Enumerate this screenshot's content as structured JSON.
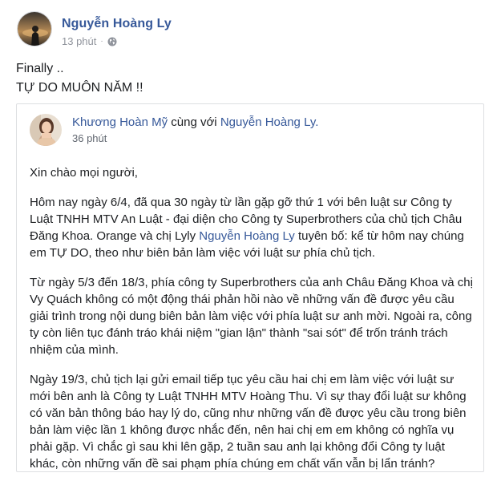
{
  "post": {
    "author": "Nguyễn Hoàng Ly",
    "time": "13 phút",
    "separator": "·",
    "privacy_icon": "globe-icon",
    "text_lines": [
      "Finally ..",
      "TỰ DO MUÔN NĂM !!"
    ]
  },
  "shared": {
    "author": "Khương Hoàn Mỹ",
    "with_text": "cùng với",
    "tagged": "Nguyễn Hoàng Ly.",
    "time": "36 phút",
    "greeting": "Xin chào mọi người,",
    "para1": {
      "line1": "Hôm nay ngày 6/4, đã qua 30 ngày từ lần gặp gỡ thứ 1 với bên luật sư Công ty",
      "line2": "Luật TNHH MTV An Luật - đại diện cho Công ty Superbrothers của chủ tịch Châu",
      "line3_a": "Đăng Khoa. Orange và chị Lyly",
      "line3_link": "Nguyễn Hoàng Ly",
      "line3_b": "tuyên bố: kể từ hôm nay chúng",
      "line4": "em TỰ DO, theo như biên bản làm việc với luật sư phía chủ tịch."
    },
    "para2": [
      "Từ ngày 5/3 đến 18/3, phía công ty Superbrothers của anh Châu Đăng Khoa và chị",
      "Vy Quách không có một động thái phản hồi nào về những vấn đề được yêu cầu",
      "giải trình trong nội dung biên bản làm việc với phía luật sư anh mời. Ngoài ra, công",
      "ty còn liên tục đánh tráo khái niệm \"gian lận\" thành \"sai sót\" để trốn tránh trách",
      "nhiệm của mình."
    ],
    "para3": [
      "Ngày 19/3, chủ tịch lại gửi email tiếp tục yêu cầu hai chị em làm việc với luật sư",
      "mới bên anh là Công ty Luật TNHH MTV Hoàng Thu. Vì sự thay đổi luật sư không",
      "có văn bản thông báo hay lý do, cũng như những vấn đề được yêu cầu trong biên",
      "bản làm việc lần 1 không được nhắc đến, nên hai chị em em không có nghĩa vụ",
      "phải gặp. Vì chắc gì sau khi lên gặp, 2 tuần sau anh lại không đổi Công ty luật",
      "khác, còn những vấn đề sai phạm phía chúng em chất vấn vẫn bị lẩn tránh?"
    ]
  },
  "colors": {
    "link": "#365899",
    "text": "#1c1e21",
    "meta": "#90949c",
    "border": "#dddfe2"
  }
}
